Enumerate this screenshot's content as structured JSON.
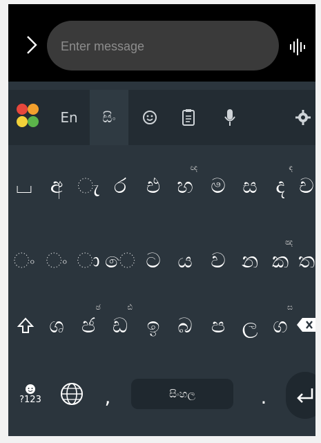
{
  "input": {
    "placeholder": "Enter message",
    "value": ""
  },
  "toolbar": {
    "lang_en": "En",
    "lang_si": "සිං"
  },
  "rows": {
    "r1": [
      "⌴",
      "අ",
      "ැ",
      "ර",
      "එ",
      "හ",
      "ම",
      "ස",
      "ද",
      "ච"
    ],
    "r1_hints": [
      "",
      "",
      "",
      "",
      "",
      "ඥ",
      "",
      "",
      "ඳ",
      ""
    ],
    "r2": [
      "ං",
      "ං",
      "ා",
      "ෙ",
      "ට",
      "ය",
      "ව",
      "න",
      "ක",
      "ත"
    ],
    "r2_hints": [
      "",
      "",
      "",
      "",
      "",
      "",
      "",
      "",
      "ඤ",
      ""
    ],
    "r3": [
      "",
      "ශ",
      "ජ",
      "ඩ",
      "ඉ",
      "බ",
      "ප",
      "ල",
      "ග",
      ""
    ],
    "r3_hints": [
      "",
      "",
      "ඡ",
      "ඪ",
      "",
      "",
      "",
      "",
      "ඝ",
      ""
    ]
  },
  "bottom": {
    "sym_label": "?123",
    "space_label": "සිංහල",
    "comma": ",",
    "period": "."
  },
  "icons": [
    "chevron-right-icon",
    "voice-input-icon",
    "app-grid-icon",
    "emoji-icon",
    "clipboard-icon",
    "mic-icon",
    "settings-icon",
    "shift-icon",
    "backspace-icon",
    "language-globe-icon",
    "enter-icon"
  ]
}
